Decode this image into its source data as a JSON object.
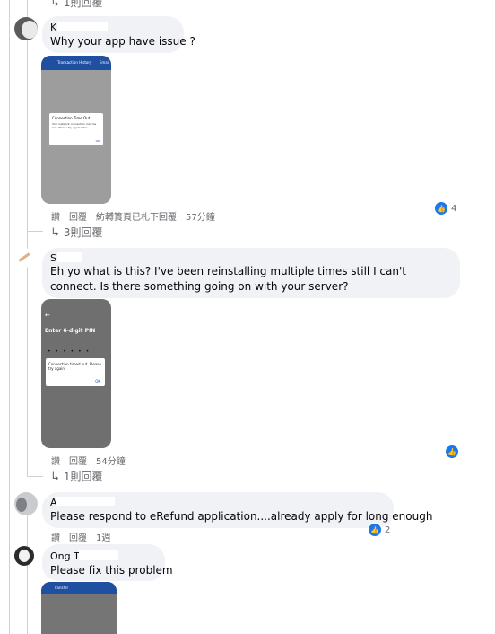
{
  "top_replies": {
    "label": "1則回覆"
  },
  "comments": [
    {
      "author": "K",
      "text": "Why your app have issue ?",
      "screenshot": {
        "header_title": "Transaction History",
        "header_action": "Email",
        "dialog_title": "Connection Time Out",
        "dialog_body": "Your network connection may be lost. Please try again later.",
        "dialog_button": "OK"
      },
      "actions": [
        "讚",
        "回覆",
        "紡𨍭簀頁已札下回覆"
      ],
      "time": "57分鐘",
      "likes": "4",
      "replies_label": "3則回覆"
    },
    {
      "author": "S",
      "text": "Eh yo what is this? I've been reinstalling multiple times still I can't connect. Is there something going on with your server?",
      "screenshot": {
        "back_icon": "←",
        "title": "Enter 6-digit PIN",
        "dialog_body": "Connection timed out. Please try again!",
        "dialog_button": "OK"
      },
      "actions": [
        "讚",
        "回覆"
      ],
      "time": "54分鐘",
      "replies_label": "1則回覆"
    },
    {
      "author": "A",
      "text": "Please respond to eRefund application....already apply for long enough",
      "actions": [
        "讚",
        "回覆"
      ],
      "time": "1週",
      "likes": "2"
    },
    {
      "author": "Ong T",
      "text": "Please fix this problem",
      "screenshot": {
        "header_title": "Transfer"
      }
    }
  ],
  "colors": {
    "bubble": "#f0f2f5",
    "like_blue": "#1877f2",
    "meta": "#65676b"
  }
}
